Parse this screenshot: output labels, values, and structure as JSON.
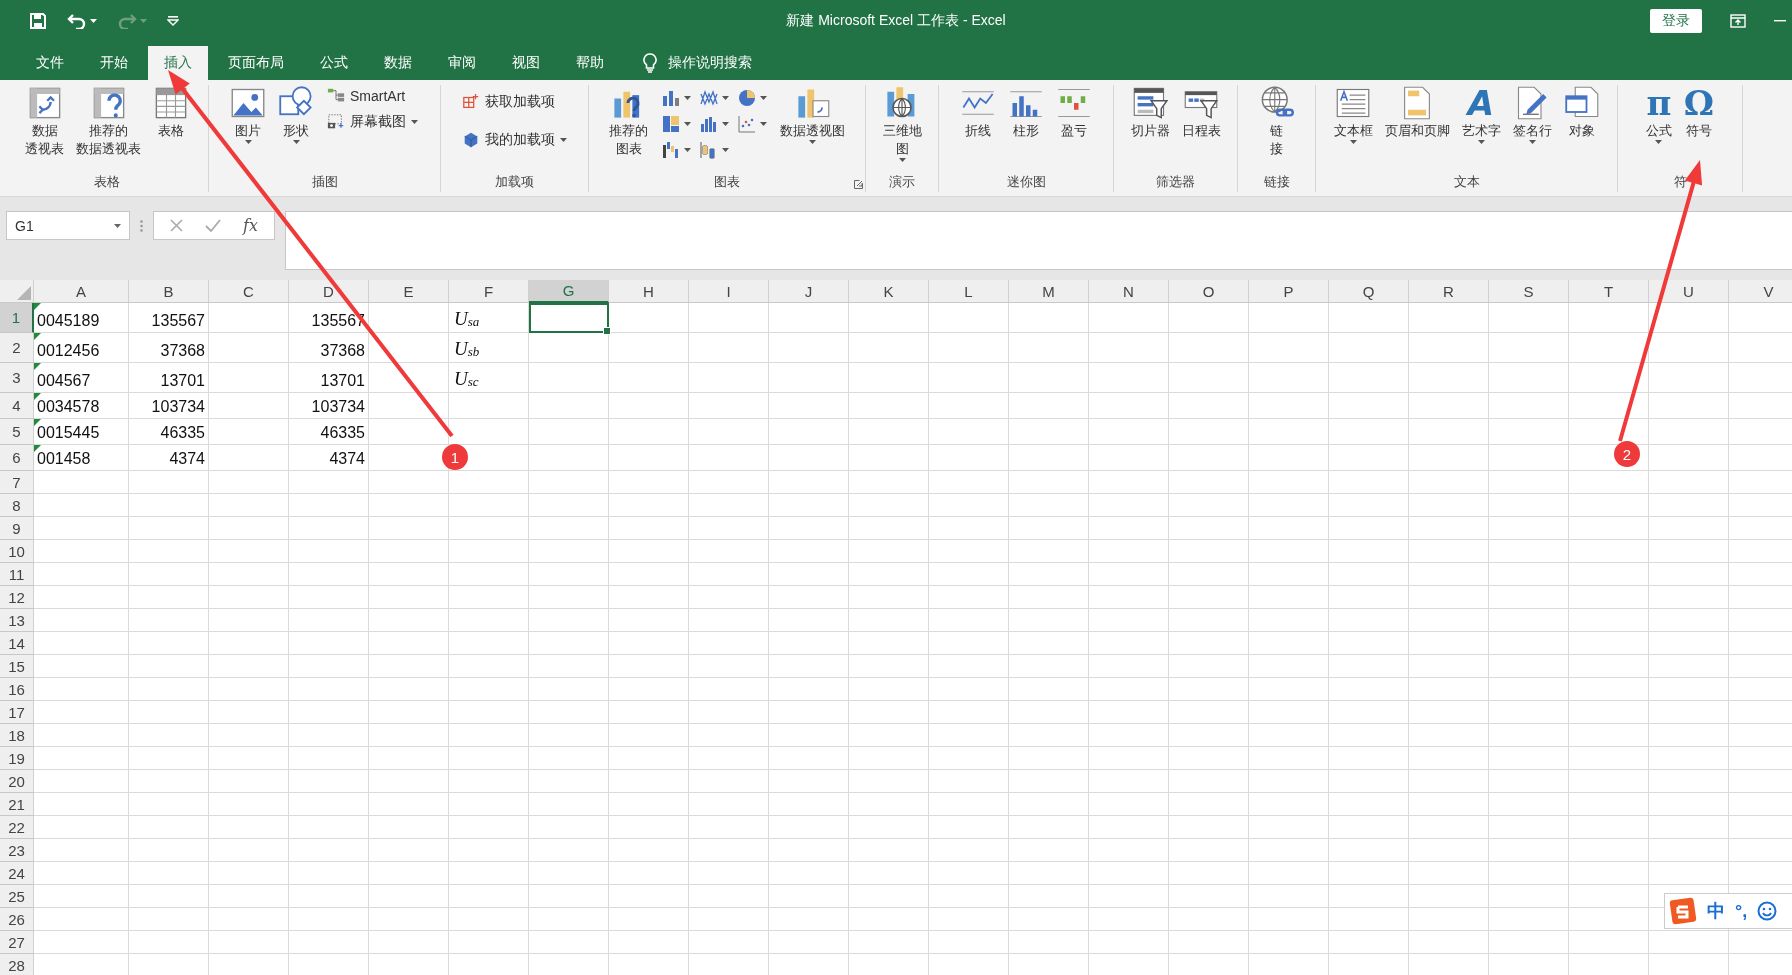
{
  "window": {
    "title": "新建 Microsoft Excel 工作表 - Excel",
    "sign_in": "登录"
  },
  "quick_access": [
    {
      "kind": "save",
      "disabled": false
    },
    {
      "kind": "undo",
      "disabled": false
    },
    {
      "kind": "redo",
      "disabled": true
    },
    {
      "kind": "customize",
      "disabled": false
    }
  ],
  "tabs": [
    {
      "label": "文件",
      "selected": false
    },
    {
      "label": "开始",
      "selected": false
    },
    {
      "label": "插入",
      "selected": true
    },
    {
      "label": "页面布局",
      "selected": false
    },
    {
      "label": "公式",
      "selected": false
    },
    {
      "label": "数据",
      "selected": false
    },
    {
      "label": "审阅",
      "selected": false
    },
    {
      "label": "视图",
      "selected": false
    },
    {
      "label": "帮助",
      "selected": false
    }
  ],
  "tell_me": "操作说明搜索",
  "ribbon": [
    {
      "label": "表格",
      "launcher": false,
      "items": [
        {
          "kind": "large",
          "label": [
            "数据",
            "透视表"
          ],
          "dropdown": false
        },
        {
          "kind": "large",
          "label": [
            "推荐的",
            "数据透视表"
          ],
          "dropdown": false
        },
        {
          "kind": "large",
          "label": "表格",
          "dropdown": false
        }
      ]
    },
    {
      "label": "插图",
      "launcher": false,
      "items": [
        {
          "kind": "large",
          "label": "图片",
          "dropdown": true
        },
        {
          "kind": "large",
          "label": "形状",
          "dropdown": true
        },
        {
          "kind": "small",
          "label": "SmartArt",
          "dropdown": false
        },
        {
          "kind": "small",
          "label": "屏幕截图",
          "dropdown": true
        }
      ]
    },
    {
      "label": "加载项",
      "launcher": false,
      "items": [
        {
          "kind": "small",
          "label": "获取加载项",
          "dropdown": false
        },
        {
          "kind": "small",
          "label": "我的加载项",
          "dropdown": true
        }
      ]
    },
    {
      "label": "图表",
      "launcher": true,
      "items": [
        {
          "kind": "large",
          "label": [
            "推荐的",
            "图表"
          ],
          "dropdown": false
        },
        {
          "kind": "icon",
          "dropdown": true
        },
        {
          "kind": "icon",
          "dropdown": true
        },
        {
          "kind": "icon",
          "dropdown": true
        },
        {
          "kind": "icon",
          "dropdown": true
        },
        {
          "kind": "icon",
          "dropdown": true
        },
        {
          "kind": "icon",
          "dropdown": true
        },
        {
          "kind": "icon",
          "dropdown": true
        },
        {
          "kind": "icon",
          "dropdown": true
        },
        {
          "kind": "large",
          "label": "数据透视图",
          "dropdown": true
        }
      ]
    },
    {
      "label": "演示",
      "launcher": false,
      "items": [
        {
          "kind": "large",
          "label": [
            "三维地",
            "图"
          ],
          "dropdown": true
        }
      ]
    },
    {
      "label": "迷你图",
      "launcher": false,
      "items": [
        {
          "kind": "large",
          "label": "折线",
          "dropdown": false
        },
        {
          "kind": "large",
          "label": "柱形",
          "dropdown": false
        },
        {
          "kind": "large",
          "label": "盈亏",
          "dropdown": false
        }
      ]
    },
    {
      "label": "筛选器",
      "launcher": false,
      "items": [
        {
          "kind": "large",
          "label": "切片器",
          "dropdown": false
        },
        {
          "kind": "large",
          "label": "日程表",
          "dropdown": false
        }
      ]
    },
    {
      "label": "链接",
      "launcher": false,
      "items": [
        {
          "kind": "large",
          "label": [
            "链",
            "接"
          ],
          "dropdown": false
        }
      ]
    },
    {
      "label": "文本",
      "launcher": false,
      "items": [
        {
          "kind": "large",
          "label": "文本框",
          "dropdown": true
        },
        {
          "kind": "large",
          "label": "页眉和页脚",
          "dropdown": false
        },
        {
          "kind": "large",
          "label": "艺术字",
          "glyph": "A",
          "dropdown": true
        },
        {
          "kind": "large",
          "label": "签名行",
          "dropdown": true
        },
        {
          "kind": "large",
          "label": "对象",
          "dropdown": false
        }
      ]
    },
    {
      "label": "符",
      "launcher": false,
      "items": [
        {
          "kind": "large",
          "label": "公式",
          "glyph": "π",
          "dropdown": true
        },
        {
          "kind": "large",
          "label": "符号",
          "glyph": "Ω",
          "dropdown": false
        }
      ]
    }
  ],
  "formula_bar": {
    "name_box": "G1",
    "function_label": "fx"
  },
  "columns": [
    {
      "label": "A",
      "selected": false
    },
    {
      "label": "B",
      "selected": false
    },
    {
      "label": "C",
      "selected": false
    },
    {
      "label": "D",
      "selected": false
    },
    {
      "label": "E",
      "selected": false
    },
    {
      "label": "F",
      "selected": false
    },
    {
      "label": "G",
      "selected": true
    },
    {
      "label": "H",
      "selected": false
    },
    {
      "label": "I",
      "selected": false
    },
    {
      "label": "J",
      "selected": false
    },
    {
      "label": "K",
      "selected": false
    },
    {
      "label": "L",
      "selected": false
    },
    {
      "label": "M",
      "selected": false
    },
    {
      "label": "N",
      "selected": false
    },
    {
      "label": "O",
      "selected": false
    },
    {
      "label": "P",
      "selected": false
    },
    {
      "label": "Q",
      "selected": false
    },
    {
      "label": "R",
      "selected": false
    },
    {
      "label": "S",
      "selected": false
    },
    {
      "label": "T",
      "selected": false
    },
    {
      "label": "U",
      "selected": false
    },
    {
      "label": "V",
      "selected": false
    }
  ],
  "rows": [
    {
      "label": "1",
      "selected": true,
      "cells": {
        "A": {
          "text": "0045189",
          "kind": "text"
        },
        "B": {
          "text": "135567",
          "kind": "number"
        },
        "D": {
          "text": "135567",
          "kind": "number"
        },
        "F": {
          "text": "U$_{sa}$",
          "kind": "formula"
        }
      }
    },
    {
      "label": "2",
      "selected": false,
      "cells": {
        "A": {
          "text": "0012456",
          "kind": "text"
        },
        "B": {
          "text": "37368",
          "kind": "number"
        },
        "D": {
          "text": "37368",
          "kind": "number"
        },
        "F": {
          "text": "U$_{sb}$",
          "kind": "formula"
        }
      }
    },
    {
      "label": "3",
      "selected": false,
      "cells": {
        "A": {
          "text": "004567",
          "kind": "text"
        },
        "B": {
          "text": "13701",
          "kind": "number"
        },
        "D": {
          "text": "13701",
          "kind": "number"
        },
        "F": {
          "text": "U$_{sc}$",
          "kind": "formula"
        }
      }
    },
    {
      "label": "4",
      "selected": false,
      "cells": {
        "A": {
          "text": "0034578",
          "kind": "text"
        },
        "B": {
          "text": "103734",
          "kind": "number"
        },
        "D": {
          "text": "103734",
          "kind": "number"
        }
      }
    },
    {
      "label": "5",
      "selected": false,
      "cells": {
        "A": {
          "text": "0015445",
          "kind": "text"
        },
        "B": {
          "text": "46335",
          "kind": "number"
        },
        "D": {
          "text": "46335",
          "kind": "number"
        }
      }
    },
    {
      "label": "6",
      "selected": false,
      "cells": {
        "A": {
          "text": "001458",
          "kind": "text"
        },
        "B": {
          "text": "4374",
          "kind": "number"
        },
        "D": {
          "text": "4374",
          "kind": "number"
        }
      }
    },
    {
      "label": "7",
      "selected": false
    },
    {
      "label": "8",
      "selected": false
    },
    {
      "label": "9",
      "selected": false
    },
    {
      "label": "10",
      "selected": false
    },
    {
      "label": "11",
      "selected": false
    },
    {
      "label": "12",
      "selected": false
    },
    {
      "label": "13",
      "selected": false
    },
    {
      "label": "14",
      "selected": false
    },
    {
      "label": "15",
      "selected": false
    },
    {
      "label": "16",
      "selected": false
    },
    {
      "label": "17",
      "selected": false
    },
    {
      "label": "18",
      "selected": false
    },
    {
      "label": "19",
      "selected": false
    },
    {
      "label": "20",
      "selected": false
    },
    {
      "label": "21",
      "selected": false
    },
    {
      "label": "22",
      "selected": false
    },
    {
      "label": "23",
      "selected": false
    },
    {
      "label": "24",
      "selected": false
    },
    {
      "label": "25",
      "selected": false
    },
    {
      "label": "26",
      "selected": false
    },
    {
      "label": "27",
      "selected": false
    },
    {
      "label": "28",
      "selected": false
    }
  ],
  "annotations": [
    {
      "label": "1"
    },
    {
      "label": "2"
    }
  ],
  "ime": {
    "mode": "中",
    "punctuation": "°,"
  }
}
